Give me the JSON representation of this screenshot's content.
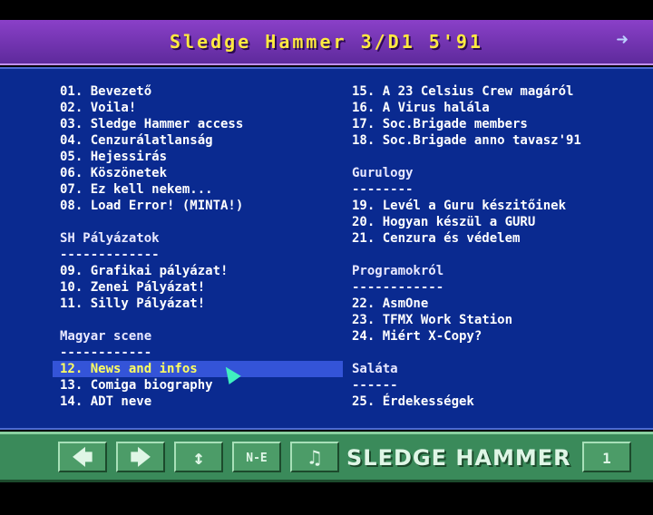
{
  "header": {
    "title": "Sledge Hammer 3/D1 5'91",
    "next_icon": "arrow-right-icon"
  },
  "left_column": [
    {
      "text": "01. Bevezető",
      "kind": "item"
    },
    {
      "text": "02. Voila!",
      "kind": "item"
    },
    {
      "text": "03. Sledge Hammer access",
      "kind": "item"
    },
    {
      "text": "04. Cenzurálatlanság",
      "kind": "item"
    },
    {
      "text": "05. Hejessirás",
      "kind": "item"
    },
    {
      "text": "06. Köszönetek",
      "kind": "item"
    },
    {
      "text": "07. Ez kell nekem...",
      "kind": "item"
    },
    {
      "text": "08. Load Error! (MINTA!)",
      "kind": "item"
    },
    {
      "text": "",
      "kind": "blank"
    },
    {
      "text": "SH Pályázatok",
      "kind": "header"
    },
    {
      "text": "-------------",
      "kind": "rule"
    },
    {
      "text": "09. Grafikai pályázat!",
      "kind": "item"
    },
    {
      "text": "10. Zenei Pályázat!",
      "kind": "item"
    },
    {
      "text": "11. Silly Pályázat!",
      "kind": "item"
    },
    {
      "text": "",
      "kind": "blank"
    },
    {
      "text": "Magyar scene",
      "kind": "header"
    },
    {
      "text": "------------",
      "kind": "rule"
    },
    {
      "text": "12. News and infos",
      "kind": "item",
      "selected": true
    },
    {
      "text": "13. Comiga biography",
      "kind": "item"
    },
    {
      "text": "14. ADT neve",
      "kind": "item"
    }
  ],
  "right_column": [
    {
      "text": "15. A 23 Celsius Crew magáról",
      "kind": "item"
    },
    {
      "text": "16. A Virus halála",
      "kind": "item"
    },
    {
      "text": "17. Soc.Brigade members",
      "kind": "item"
    },
    {
      "text": "18. Soc.Brigade anno tavasz'91",
      "kind": "item"
    },
    {
      "text": "",
      "kind": "blank"
    },
    {
      "text": "Gurulogy",
      "kind": "header"
    },
    {
      "text": "--------",
      "kind": "rule"
    },
    {
      "text": "19. Levél a Guru készitőinek",
      "kind": "item"
    },
    {
      "text": "20. Hogyan készül a GURU",
      "kind": "item"
    },
    {
      "text": "21. Cenzura és védelem",
      "kind": "item"
    },
    {
      "text": "",
      "kind": "blank"
    },
    {
      "text": "Programokról",
      "kind": "header"
    },
    {
      "text": "------------",
      "kind": "rule"
    },
    {
      "text": "22. AsmOne",
      "kind": "item"
    },
    {
      "text": "23. TFMX Work Station",
      "kind": "item"
    },
    {
      "text": "24. Miért X-Copy?",
      "kind": "item"
    },
    {
      "text": "",
      "kind": "blank"
    },
    {
      "text": "Saláta",
      "kind": "header"
    },
    {
      "text": "------",
      "kind": "rule"
    },
    {
      "text": "25. Érdekességek",
      "kind": "item"
    }
  ],
  "toolbar": {
    "prev_icon": "arrow-left-icon",
    "next_icon": "arrow-right-icon",
    "scroll_icon": "up-down-arrow-icon",
    "ne_label": "N-E",
    "music_icon": "music-note-icon",
    "brand": "SLEDGE HAMMER",
    "page_number": "1"
  }
}
